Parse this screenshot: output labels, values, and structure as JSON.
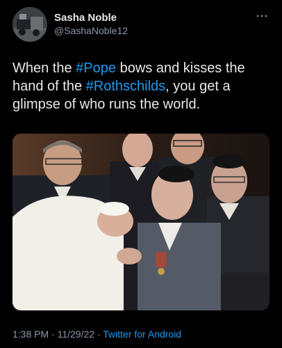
{
  "user": {
    "display_name": "Sasha Noble",
    "handle": "@SashaNoble12"
  },
  "tweet": {
    "text_parts": [
      {
        "text": "When the ",
        "type": "plain"
      },
      {
        "text": "#Pope",
        "type": "hashtag"
      },
      {
        "text": " bows and kisses the hand of the ",
        "type": "plain"
      },
      {
        "text": "#Rothschilds",
        "type": "hashtag"
      },
      {
        "text": ", you get a glimpse of who runs the world.",
        "type": "plain"
      }
    ]
  },
  "meta": {
    "time": "1:38 PM",
    "separator": " · ",
    "date": "11/29/22",
    "source": "Twitter for Android"
  },
  "icons": {
    "more": "more-horizontal-icon"
  },
  "colors": {
    "background": "#000000",
    "text": "#e7e9ea",
    "secondary": "#8b98a5",
    "accent": "#1d9bf0"
  }
}
